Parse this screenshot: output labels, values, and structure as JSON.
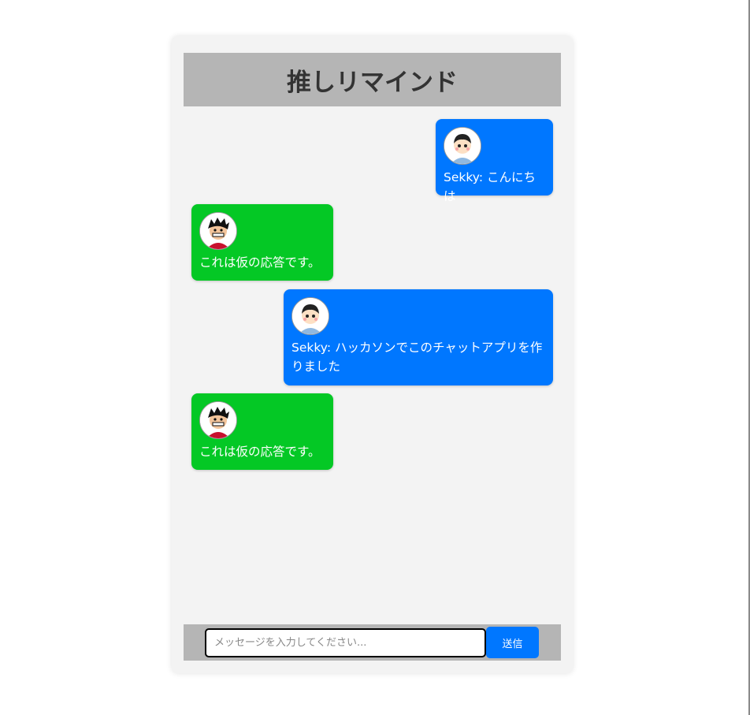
{
  "app": {
    "title": "推しリマインド"
  },
  "messages": [
    {
      "sender": "user",
      "avatar": "boy-avatar-icon",
      "text": "Sekky: こんにちは"
    },
    {
      "sender": "bot",
      "avatar": "anime-character-avatar-icon",
      "text": "これは仮の応答です。"
    },
    {
      "sender": "user",
      "avatar": "boy-avatar-icon",
      "text": "Sekky: ハッカソンでこのチャットアプリを作りました"
    },
    {
      "sender": "bot",
      "avatar": "anime-character-avatar-icon",
      "text": "これは仮の応答です。"
    }
  ],
  "input": {
    "placeholder": "メッセージを入力してください...",
    "value": ""
  },
  "send_button": {
    "label": "送信"
  },
  "colors": {
    "user_bubble": "#0077ff",
    "bot_bubble": "#04c825",
    "header_bg": "#b5b5b5",
    "app_bg": "#f3f3f3",
    "send_button": "#0077ff"
  }
}
